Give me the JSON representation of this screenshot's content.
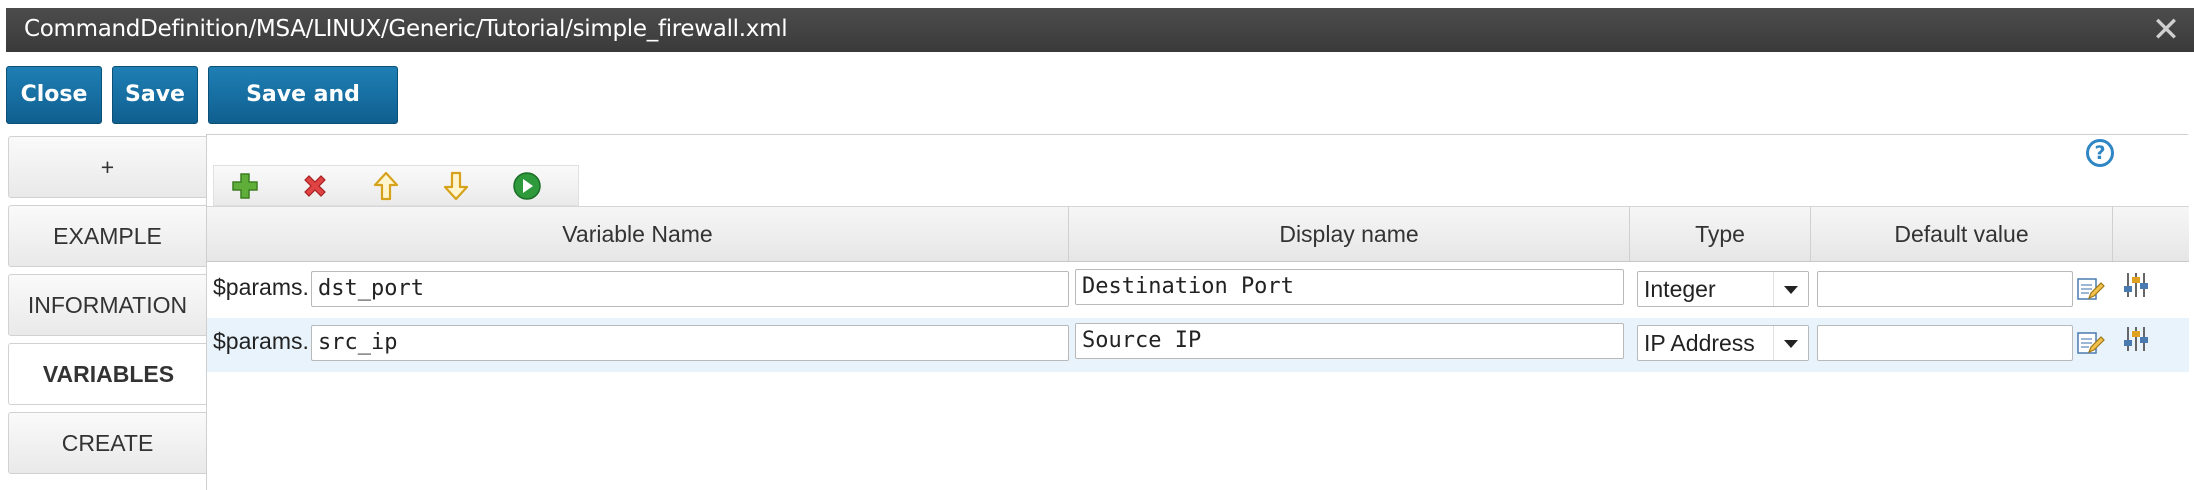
{
  "window": {
    "title": "CommandDefinition/MSA/LINUX/Generic/Tutorial/simple_firewall.xml",
    "close_icon": "close-x-icon"
  },
  "toolbar": {
    "close_label": "Close",
    "save_label": "Save",
    "save_close_label": "Save and Close"
  },
  "tabs": [
    {
      "label": "+"
    },
    {
      "label": "EXAMPLE"
    },
    {
      "label": "INFORMATION"
    },
    {
      "label": "VARIABLES",
      "active": true
    },
    {
      "label": "CREATE"
    }
  ],
  "grid": {
    "icons": [
      "add-icon",
      "delete-icon",
      "move-up-icon",
      "move-down-icon",
      "run-icon"
    ],
    "columns": [
      "Variable Name",
      "Display name",
      "Type",
      "Default value"
    ],
    "rows": [
      {
        "prefix": "$params.",
        "name": "dst_port",
        "display": "Destination Port",
        "type": "Integer",
        "default": ""
      },
      {
        "prefix": "$params.",
        "name": "src_ip",
        "display": "Source IP",
        "type": "IP Address",
        "default": ""
      }
    ]
  },
  "colors": {
    "button_blue": "#1a72a6",
    "titlebar": "#434343",
    "row_highlight": "#e8f3fb"
  }
}
